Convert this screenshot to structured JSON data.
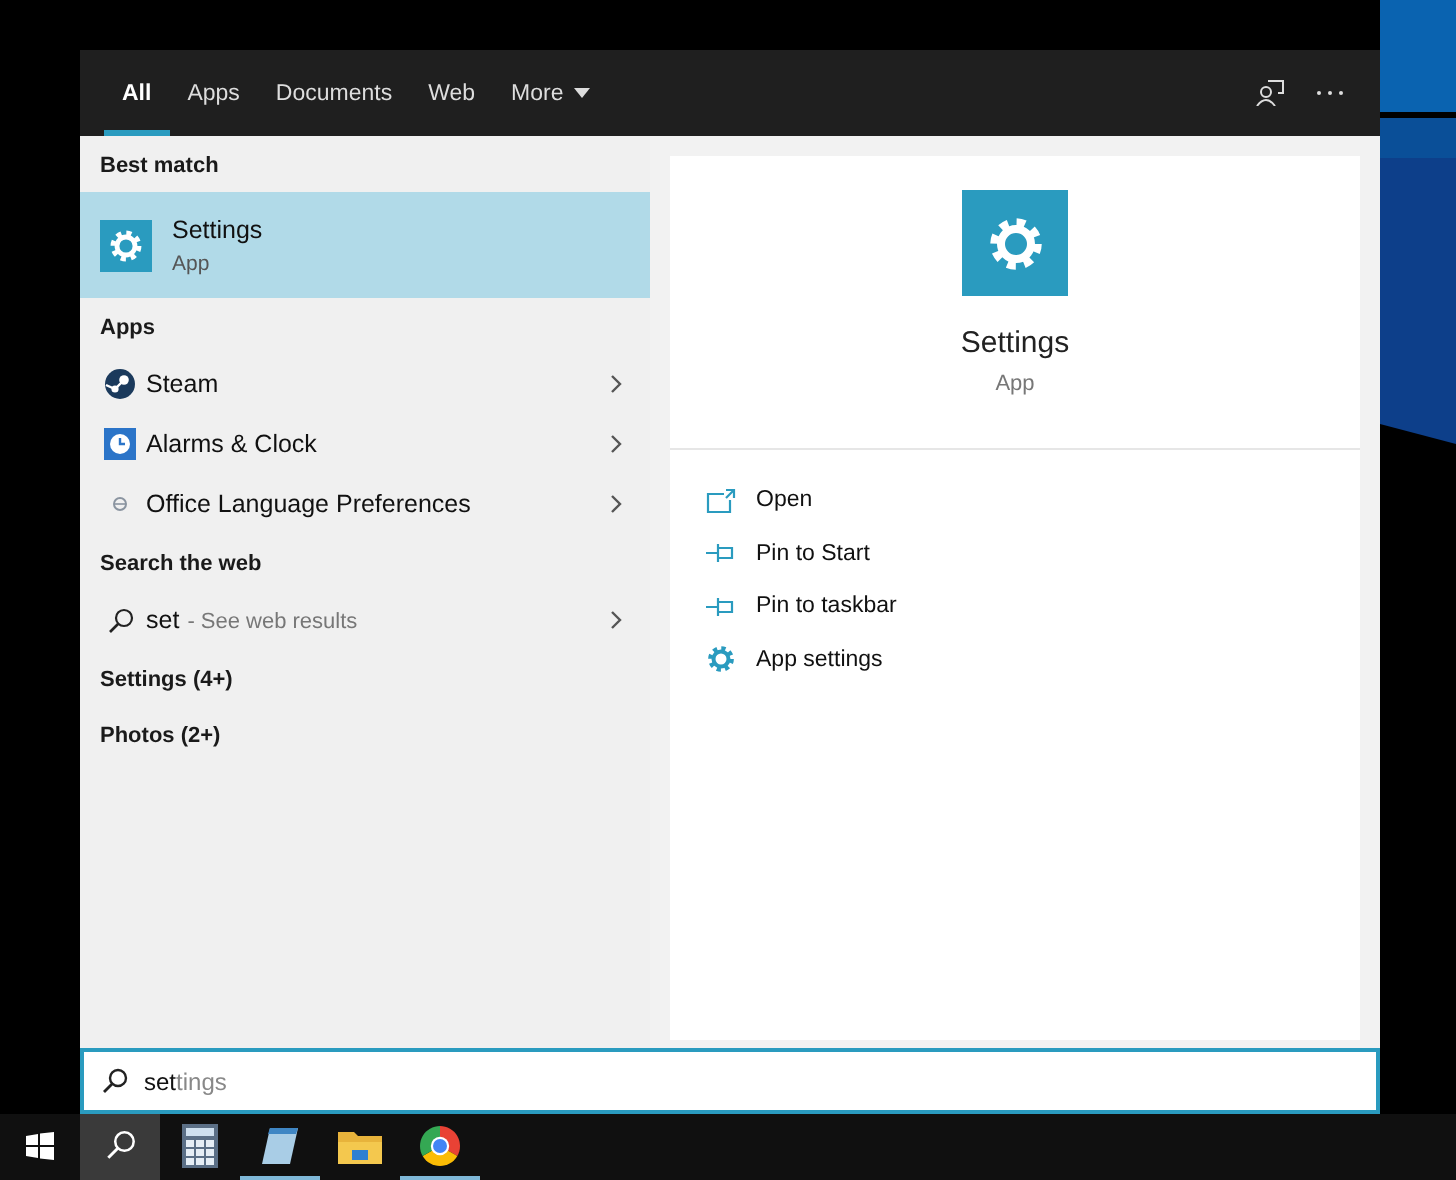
{
  "tabs": [
    {
      "label": "All",
      "selected": true,
      "has_menu": false
    },
    {
      "label": "Apps",
      "selected": false,
      "has_menu": false
    },
    {
      "label": "Documents",
      "selected": false,
      "has_menu": false
    },
    {
      "label": "Web",
      "selected": false,
      "has_menu": false
    },
    {
      "label": "More",
      "selected": false,
      "has_menu": true
    }
  ],
  "results": [
    {
      "heading": "Best match",
      "items": [
        {
          "kind": "best",
          "title": "Settings",
          "subtitle": "App",
          "selected": true
        }
      ]
    },
    {
      "heading": "Apps",
      "items": [
        {
          "kind": "app",
          "title": "Steam",
          "selected": false
        },
        {
          "kind": "app",
          "title": "Alarms & Clock",
          "selected": false
        },
        {
          "kind": "app",
          "title": "Office Language Preferences",
          "selected": false
        }
      ]
    },
    {
      "heading": "Search the web",
      "items": [
        {
          "kind": "web",
          "query": "set",
          "hint": "- See web results",
          "selected": false
        }
      ]
    },
    {
      "heading": "Settings (4+)"
    },
    {
      "heading": "Photos (2+)"
    }
  ],
  "details": {
    "title": "Settings",
    "subtitle": "App",
    "actions": [
      {
        "label": "Open"
      },
      {
        "label": "Pin to Start"
      },
      {
        "label": "Pin to taskbar"
      },
      {
        "label": "App settings"
      }
    ]
  },
  "search": {
    "value": "set",
    "suggestion": "tings"
  },
  "taskbar": {
    "search_active": true,
    "apps": [
      {
        "running": false
      },
      {
        "running": true
      },
      {
        "running": false
      },
      {
        "running": true
      }
    ]
  }
}
